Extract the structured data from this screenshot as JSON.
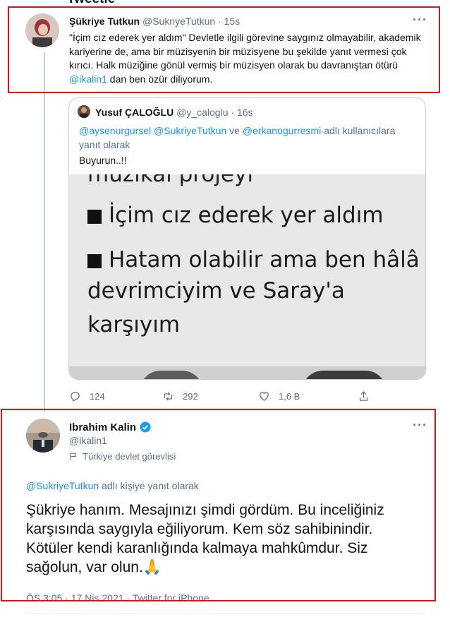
{
  "header": {
    "title_cut": "Tweetle"
  },
  "tweet1": {
    "name": "Şükriye Tutkun",
    "handle": "@SukriyeTutkun",
    "sep": "·",
    "time": "15s",
    "text_1": "\"İçim cız ederek yer aldım\" Devletle ilgili görevine saygınız olmayabilir, akademik kariyerine de, ama bir müzisyenin bir müzisyene bu şekilde yanıt vermesi    çok kırıcı. Halk müziğine gönül vermiş bir müzisyen olarak bu davranıştan ötürü ",
    "mention": "@ikalin1",
    "text_2": " dan ben özür diliyorum.",
    "more_icon": "more-icon"
  },
  "quote": {
    "name": "Yusuf ÇALOĞLU",
    "handle": "@y_caloglu",
    "sep": "·",
    "time": "16s",
    "reply_to_1": "@aysenurgursel",
    "reply_to_2": "@SukriyeTutkun",
    "reply_conj": "ve",
    "reply_to_3": "@erkanogurresmi",
    "reply_suffix": "adlı kullanıcılara yanıt olarak",
    "text": "Buyurun..!!",
    "image": {
      "line_top": "müzikal projeyi",
      "line_1": "İçim cız ederek yer aldım",
      "line_2": "Hatam olabilir ama ben hâlâ",
      "line_3": "devrimciyim ve Saray'a",
      "line_4": "karşıyım"
    }
  },
  "actions": {
    "reply_count": "124",
    "retweet_count": "292",
    "like_count": "1,6 B",
    "share_count": ""
  },
  "tweet2": {
    "name": "Ibrahim Kalin",
    "verified_icon": "verified-badge-icon",
    "handle": "@ikalin1",
    "label": "Türkiye devlet görevlisi",
    "reply_mention": "@SukriyeTutkun",
    "reply_suffix": "adlı kişiye yanıt olarak",
    "text": "Şükriye hanım. Mesajınızı şimdi gördüm. Bu inceliğiniz karşısında saygıyla eğiliyorum. Kem söz sahibinindir. Kötüler kendi karanlığında kalmaya mahkûmdur. Siz sağolun, var olun.",
    "emoji": "🙏",
    "date": "ÖS 3:05 · 17 Nis 2021 · Twitter for iPhone"
  },
  "colors": {
    "accent": "#1b95e0",
    "annotation": "#d9141c",
    "muted": "#5b7083"
  }
}
